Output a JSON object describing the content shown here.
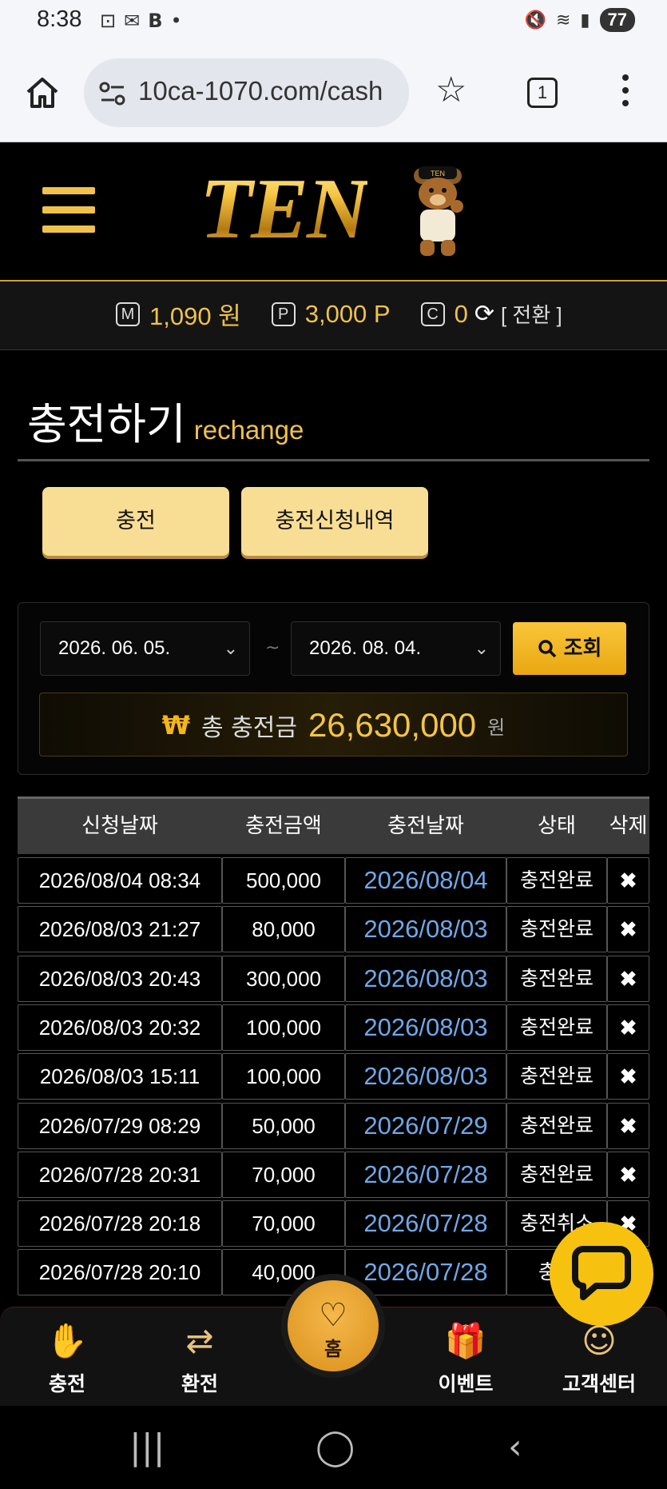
{
  "status": {
    "time": "8:38",
    "battery": "77"
  },
  "browser": {
    "url": "10ca-1070.com/cash",
    "tab_count": "1"
  },
  "site": {
    "logo_text": "TEN",
    "logo_badge": "TEN",
    "balance": {
      "m_icon": "M",
      "money": "1,090 원",
      "p_icon": "P",
      "points": "3,000 P",
      "c_icon": "C",
      "coins": "0",
      "switch_label": "[ 전환 ]"
    }
  },
  "page": {
    "title": "충전하기",
    "subtitle": "rechange",
    "tabs": [
      "충전",
      "충전신청내역"
    ]
  },
  "filter": {
    "date_from": "2026. 06. 05.",
    "date_to": "2026. 08. 04.",
    "separator": "~",
    "search_label": "조회",
    "total_icon": "₩",
    "total_label": "총 충전금",
    "total_amount": "26,630,000",
    "total_unit": "원"
  },
  "table": {
    "headers": [
      "신청날짜",
      "충전금액",
      "충전날짜",
      "상태",
      "삭제"
    ],
    "rows": [
      [
        "2026/08/04 08:34",
        "500,000",
        "2026/08/04",
        "충전완료",
        "✖"
      ],
      [
        "2026/08/03 21:27",
        "80,000",
        "2026/08/03",
        "충전완료",
        "✖"
      ],
      [
        "2026/08/03 20:43",
        "300,000",
        "2026/08/03",
        "충전완료",
        "✖"
      ],
      [
        "2026/08/03 20:32",
        "100,000",
        "2026/08/03",
        "충전완료",
        "✖"
      ],
      [
        "2026/08/03 15:11",
        "100,000",
        "2026/08/03",
        "충전완료",
        "✖"
      ],
      [
        "2026/07/29 08:29",
        "50,000",
        "2026/07/29",
        "충전완료",
        "✖"
      ],
      [
        "2026/07/28 20:31",
        "70,000",
        "2026/07/28",
        "충전완료",
        "✖"
      ],
      [
        "2026/07/28 20:18",
        "70,000",
        "2026/07/28",
        "충전취소",
        "✖"
      ],
      [
        "2026/07/28 20:10",
        "40,000",
        "2026/07/28",
        "충전",
        "✖"
      ]
    ]
  },
  "bottom_nav": [
    {
      "label": "충전",
      "icon": "deposit-icon"
    },
    {
      "label": "환전",
      "icon": "exchange-icon"
    },
    {
      "label": "홈",
      "icon": "home-heart-icon"
    },
    {
      "label": "이벤트",
      "icon": "gift-icon"
    },
    {
      "label": "고객센터",
      "icon": "support-icon"
    }
  ],
  "colors": {
    "accent": "#f0c24a",
    "link_blue": "#6fa8e8",
    "button_gold": "#f8dd95"
  }
}
